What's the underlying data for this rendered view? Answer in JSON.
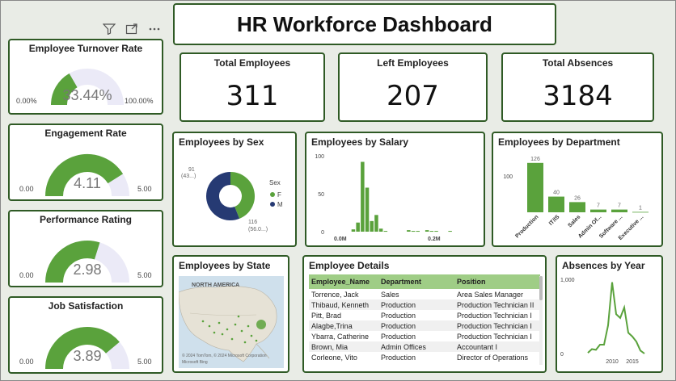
{
  "title": "HR Workforce Dashboard",
  "toolbar": {
    "icons": [
      "filter-icon",
      "focus-mode-icon",
      "more-options-icon"
    ]
  },
  "kpis": [
    {
      "label": "Total Employees",
      "value": "311"
    },
    {
      "label": "Left Employees",
      "value": "207"
    },
    {
      "label": "Total Absences",
      "value": "3184"
    }
  ],
  "gauges": [
    {
      "title": "Employee Turnover Rate",
      "value": 33.44,
      "display": "33.44%",
      "min": "0.00%",
      "max": "100.00%",
      "min_v": 0,
      "max_v": 100
    },
    {
      "title": "Engagement Rate",
      "value": 4.11,
      "display": "4.11",
      "min": "0.00",
      "max": "5.00",
      "min_v": 0,
      "max_v": 5
    },
    {
      "title": "Performance Rating",
      "value": 2.98,
      "display": "2.98",
      "min": "0.00",
      "max": "5.00",
      "min_v": 0,
      "max_v": 5
    },
    {
      "title": "Job Satisfaction",
      "value": 3.89,
      "display": "3.89",
      "min": "0.00",
      "max": "5.00",
      "min_v": 0,
      "max_v": 5
    }
  ],
  "colors": {
    "green": "#5aa23c",
    "navy": "#263a73",
    "track": "#ebeaf7",
    "border": "#2f5a25",
    "table_header": "#9fcd86"
  },
  "sex_chart": {
    "title": "Employees by Sex",
    "legend_title": "Sex",
    "label_f_count": "91",
    "label_f_pct": "(43...)",
    "label_m_count": "116",
    "label_m_pct": "(56.0...)"
  },
  "salary_chart": {
    "title": "Employees by Salary",
    "y_ticks": [
      "100",
      "50",
      "0"
    ],
    "x_ticks": [
      "0.0M",
      "0.2M"
    ]
  },
  "department_chart": {
    "title": "Employees by Department",
    "y_tick": "100"
  },
  "state_map": {
    "title": "Employees by State",
    "region_label": "NORTH AMERICA",
    "attribution": "© 2024 TomTom, © 2024 Microsoft Corporation",
    "brand": "Microsoft Bing"
  },
  "employee_details": {
    "title": "Employee Details",
    "columns": [
      "Employee_Name",
      "Department",
      "Position"
    ],
    "rows": [
      [
        "Torrence, Jack",
        "Sales",
        "Area Sales Manager"
      ],
      [
        "Thibaud, Kenneth",
        "Production",
        "Production Technician II"
      ],
      [
        "Pitt, Brad",
        "Production",
        "Production Technician I"
      ],
      [
        "Alagbe,Trina",
        "Production",
        "Production Technician I"
      ],
      [
        "Ybarra, Catherine",
        "Production",
        "Production Technician I"
      ],
      [
        "Brown, Mia",
        "Admin Offices",
        "Accountant I"
      ],
      [
        "Corleone, Vito",
        "Production",
        "Director of Operations"
      ]
    ]
  },
  "absences_chart": {
    "title": "Absences by Year",
    "y_ticks": [
      "1,000",
      "0"
    ],
    "x_ticks": [
      "2010",
      "2015"
    ]
  },
  "chart_data": [
    {
      "type": "pie",
      "title": "Employees by Sex",
      "legend_title": "Sex",
      "categories": [
        "F",
        "M"
      ],
      "values": [
        91,
        116
      ],
      "colors": [
        "#5aa23c",
        "#263a73"
      ],
      "legend_placement": "right"
    },
    {
      "type": "bar",
      "title": "Employees by Salary",
      "x": [
        0.03,
        0.04,
        0.05,
        0.06,
        0.07,
        0.08,
        0.09,
        0.1,
        0.11,
        0.12,
        0.13,
        0.14,
        0.15,
        0.16,
        0.17,
        0.18,
        0.19,
        0.2,
        0.21,
        0.22,
        0.23,
        0.24,
        0.25
      ],
      "values": [
        0,
        3,
        12,
        92,
        58,
        14,
        22,
        4,
        1,
        0,
        0,
        0,
        0,
        2,
        1,
        1,
        0,
        2,
        1,
        1,
        0,
        0,
        1
      ],
      "ylim": [
        0,
        100
      ],
      "x_ticks": [
        "0.0M",
        "0.2M"
      ],
      "y_ticks": [
        0,
        50,
        100
      ]
    },
    {
      "type": "bar",
      "title": "Employees by Department",
      "categories": [
        "Production",
        "IT/IS",
        "Sales",
        "Admin Of...",
        "Software ...",
        "Executive ..."
      ],
      "values": [
        126,
        40,
        26,
        7,
        7,
        1
      ],
      "ylim": [
        0,
        140
      ],
      "y_ticks": [
        100
      ]
    },
    {
      "type": "line",
      "title": "Absences by Year",
      "x": [
        2004,
        2005,
        2006,
        2007,
        2008,
        2009,
        2010,
        2011,
        2012,
        2013,
        2014,
        2015,
        2016,
        2017,
        2018
      ],
      "values": [
        10,
        60,
        50,
        120,
        120,
        380,
        960,
        530,
        480,
        620,
        280,
        230,
        160,
        40,
        0
      ],
      "ylim": [
        0,
        1000
      ],
      "x_ticks": [
        2010,
        2015
      ],
      "y_ticks": [
        0,
        1000
      ]
    }
  ]
}
